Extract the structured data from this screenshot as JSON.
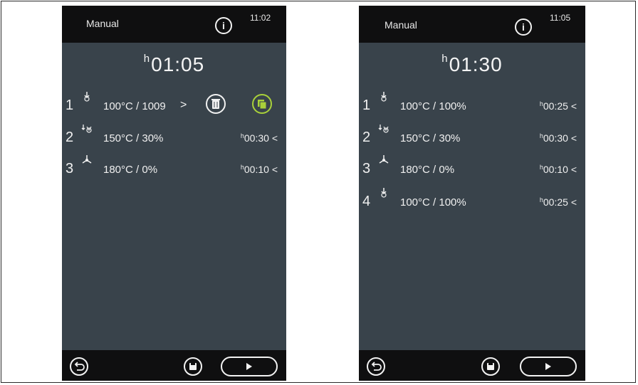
{
  "screens": [
    {
      "mode_label": "Manual",
      "clock": "11:02",
      "total_prefix": "h",
      "total_time": "01:05",
      "steps": [
        {
          "num": "1",
          "icon": "steam-icon",
          "values": "100°C / 1009",
          "arrow": ">",
          "time_prefix": "",
          "time": ""
        },
        {
          "num": "2",
          "icon": "combi-icon",
          "values": "150°C / 30%",
          "arrow": "",
          "time_prefix": "h",
          "time": "00:30 <"
        },
        {
          "num": "3",
          "icon": "fan-icon",
          "values": "180°C / 0%",
          "arrow": "",
          "time_prefix": "h",
          "time": "00:10 <"
        }
      ],
      "actions": {
        "delete_icon": "trash-icon",
        "copy_icon": "copy-icon"
      }
    },
    {
      "mode_label": "Manual",
      "clock": "11:05",
      "total_prefix": "h",
      "total_time": "01:30",
      "steps": [
        {
          "num": "1",
          "icon": "steam-icon",
          "values": "100°C / 100%",
          "time_prefix": "h",
          "time": "00:25 <"
        },
        {
          "num": "2",
          "icon": "combi-icon",
          "values": "150°C / 30%",
          "time_prefix": "h",
          "time": "00:30 <"
        },
        {
          "num": "3",
          "icon": "fan-icon",
          "values": "180°C / 0%",
          "time_prefix": "h",
          "time": "00:10 <"
        },
        {
          "num": "4",
          "icon": "steam-icon",
          "values": "100°C / 100%",
          "time_prefix": "h",
          "time": "00:25 <"
        }
      ]
    }
  ],
  "colors": {
    "screen_bg": "#39434b",
    "bar_bg": "#0f0f10",
    "accent_green": "#a9d13a"
  }
}
